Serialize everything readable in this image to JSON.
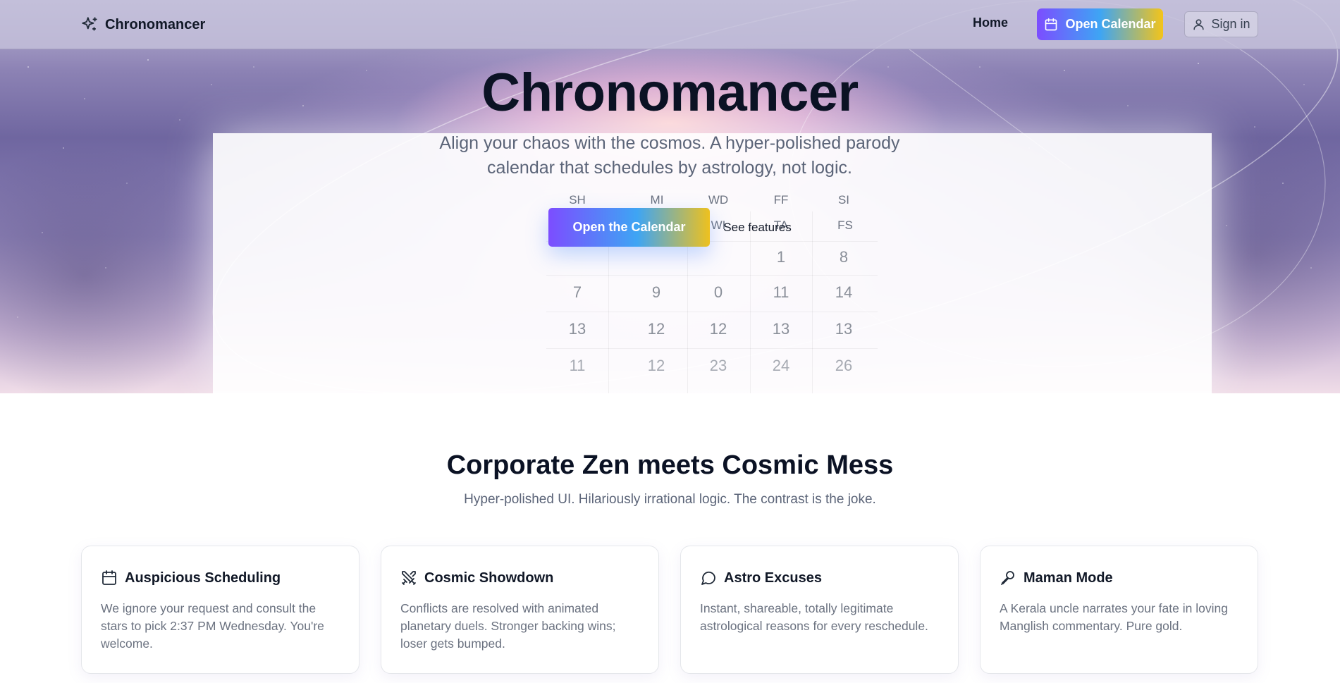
{
  "header": {
    "brand_name": "Chronomancer",
    "nav_home": "Home",
    "open_calendar_label": "Open Calendar",
    "sign_in_label": "Sign in"
  },
  "hero": {
    "title": "Chronomancer",
    "subtitle": "Align your chaos with the cosmos. A hyper-polished parody calendar that schedules by astrology, not logic.",
    "primary_cta": "Open the Calendar",
    "secondary_cta": "See features"
  },
  "background_calendar": {
    "weekday_headers": [
      "SH",
      "MI",
      "WD",
      "FF",
      "SI"
    ],
    "sub_headers": [
      "",
      "",
      "WI",
      "TA",
      "FS"
    ],
    "rows": [
      [
        "",
        "",
        "",
        "1",
        "8"
      ],
      [
        "7",
        "9",
        "0",
        "11",
        "14"
      ],
      [
        "13",
        "12",
        "12",
        "13",
        "13"
      ],
      [
        "11",
        "12",
        "23",
        "24",
        "26"
      ]
    ]
  },
  "features": {
    "title": "Corporate Zen meets Cosmic Mess",
    "subtitle": "Hyper-polished UI. Hilariously irrational logic. The contrast is the joke.",
    "cards": [
      {
        "icon": "calendar-icon",
        "title": "Auspicious Scheduling",
        "text": "We ignore your request and consult the stars to pick 2:37 PM Wednesday. You're welcome."
      },
      {
        "icon": "swords-icon",
        "title": "Cosmic Showdown",
        "text": "Conflicts are resolved with animated planetary duels. Stronger backing wins; loser gets bumped."
      },
      {
        "icon": "message-circle-icon",
        "title": "Astro Excuses",
        "text": "Instant, shareable, totally legitimate astrological reasons for every reschedule."
      },
      {
        "icon": "mic-icon",
        "title": "Maman Mode",
        "text": "A Kerala uncle narrates your fate in loving Manglish commentary. Pure gold."
      }
    ]
  },
  "colors": {
    "accent_gradient_start": "#7c4dff",
    "accent_gradient_mid": "#3ea5f4",
    "accent_gradient_end": "#f3c41a",
    "heading": "#0b1224",
    "muted_text": "#5b6478"
  }
}
